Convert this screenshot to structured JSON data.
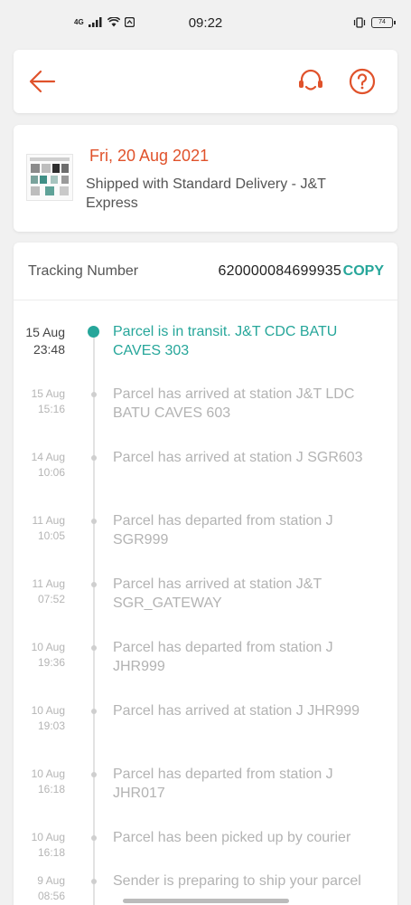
{
  "status_bar": {
    "network": "4G",
    "time": "09:22",
    "battery": "74"
  },
  "header": {
    "back_icon": "arrow-left-icon",
    "support_icon": "headset-icon",
    "help_icon": "question-circle-icon",
    "accent_color": "#e0522b"
  },
  "shipment": {
    "date": "Fri, 20 Aug 2021",
    "shipped_with": "Shipped with Standard Delivery  - J&T Express"
  },
  "tracking": {
    "label": "Tracking Number",
    "number": "620000084699935",
    "copy_label": "COPY",
    "accent_color": "#26a69a"
  },
  "events": [
    {
      "day": "15 Aug",
      "time": "23:48",
      "text": "Parcel is in transit. J&T CDC BATU CAVES 303"
    },
    {
      "day": "15 Aug",
      "time": "15:16",
      "text": "Parcel has arrived at station J&T LDC BATU CAVES 603"
    },
    {
      "day": "14 Aug",
      "time": "10:06",
      "text": "Parcel has arrived at station J SGR603"
    },
    {
      "day": "11 Aug",
      "time": "10:05",
      "text": "Parcel has departed from station J SGR999"
    },
    {
      "day": "11 Aug",
      "time": "07:52",
      "text": "Parcel has arrived at station J&T SGR_GATEWAY"
    },
    {
      "day": "10 Aug",
      "time": "19:36",
      "text": "Parcel has departed from station J JHR999"
    },
    {
      "day": "10 Aug",
      "time": "19:03",
      "text": "Parcel has arrived at station J JHR999"
    },
    {
      "day": "10 Aug",
      "time": "16:18",
      "text": "Parcel has departed from station J JHR017"
    },
    {
      "day": "10 Aug",
      "time": "16:18",
      "text": "Parcel has been picked up by courier"
    },
    {
      "day": "9 Aug",
      "time": "08:56",
      "text": "Sender is preparing to ship your parcel"
    }
  ]
}
